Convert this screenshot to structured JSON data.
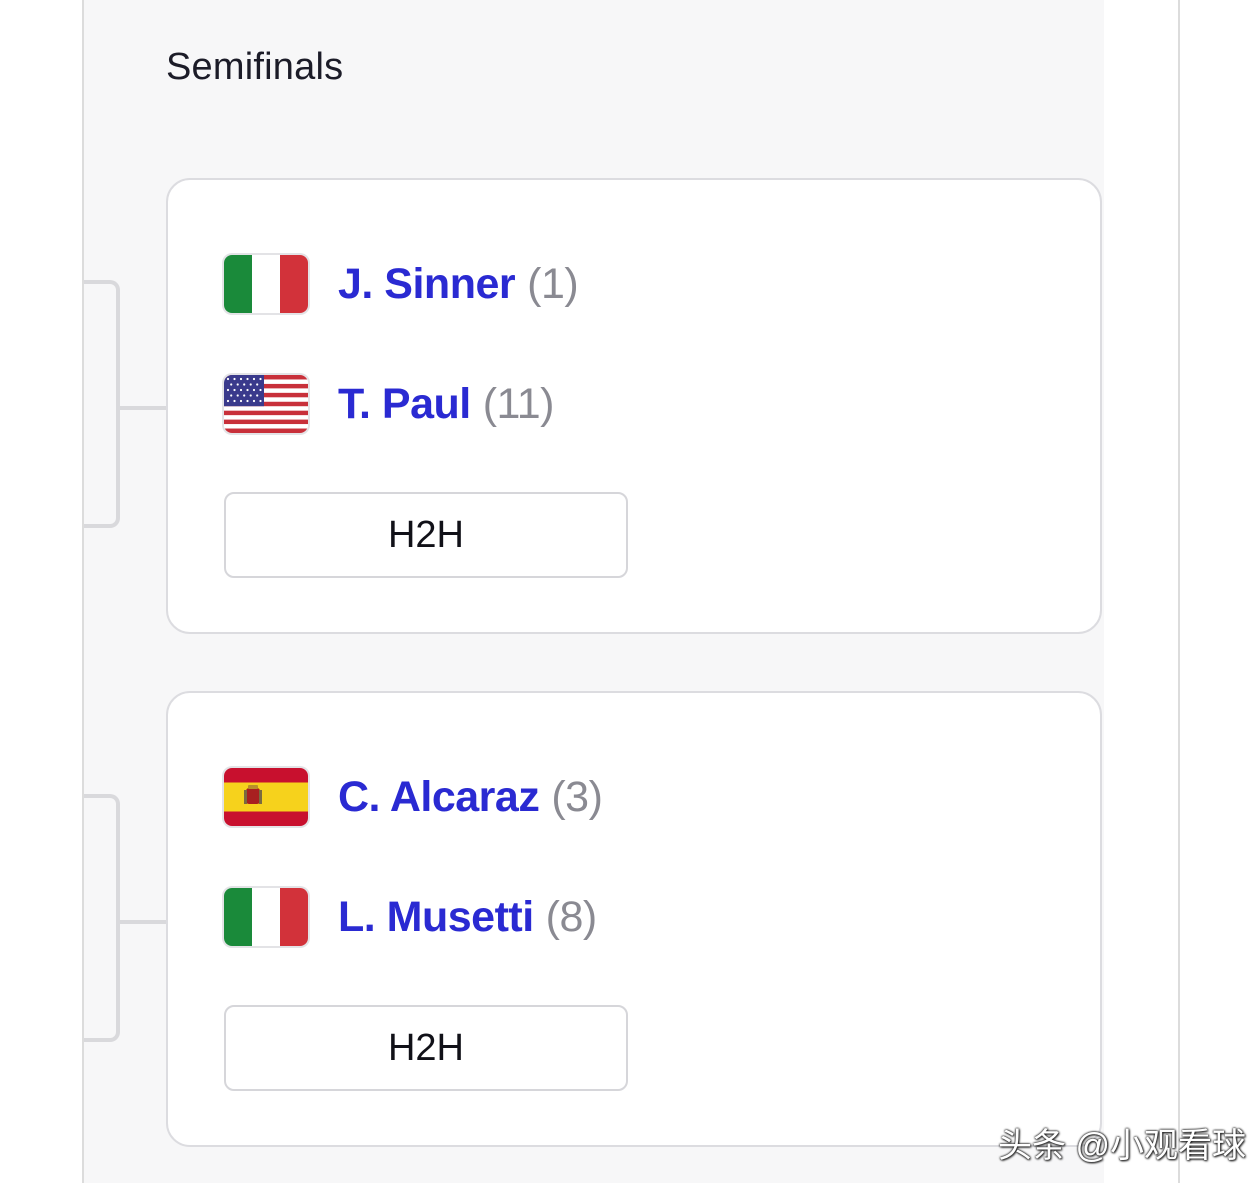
{
  "round": {
    "title": "Semifinals"
  },
  "matches": [
    {
      "players": [
        {
          "name": "J. Sinner",
          "seed": "(1)",
          "flag_icon": "italy-flag-icon"
        },
        {
          "name": "T. Paul",
          "seed": "(11)",
          "flag_icon": "usa-flag-icon"
        }
      ],
      "h2h_label": "H2H"
    },
    {
      "players": [
        {
          "name": "C. Alcaraz",
          "seed": "(3)",
          "flag_icon": "spain-flag-icon"
        },
        {
          "name": "L. Musetti",
          "seed": "(8)",
          "flag_icon": "italy-flag-icon"
        }
      ],
      "h2h_label": "H2H"
    }
  ],
  "watermark": {
    "text": "头条 @小观看球"
  },
  "colors": {
    "player_name": "#2a2ad2",
    "seed": "#8a8a92",
    "panel_background": "#f7f7f8",
    "card_border": "#dcdce0",
    "bracket_line": "#d9d9dc"
  }
}
